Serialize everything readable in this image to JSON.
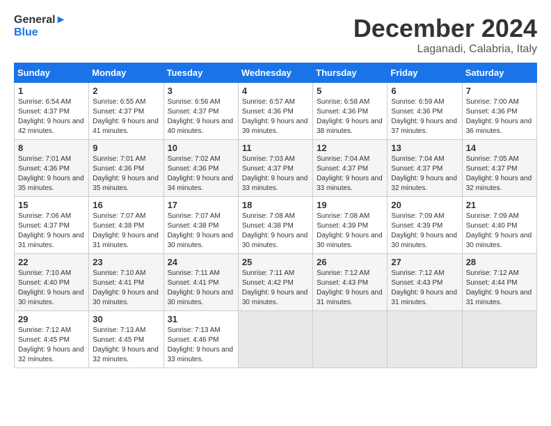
{
  "header": {
    "logo_general": "General",
    "logo_blue": "Blue",
    "month_title": "December 2024",
    "location": "Laganadi, Calabria, Italy"
  },
  "calendar": {
    "days_of_week": [
      "Sunday",
      "Monday",
      "Tuesday",
      "Wednesday",
      "Thursday",
      "Friday",
      "Saturday"
    ],
    "weeks": [
      [
        null,
        null,
        null,
        null,
        null,
        null,
        null
      ]
    ],
    "cells": [
      {
        "day": "",
        "info": ""
      },
      {
        "day": "",
        "info": ""
      },
      {
        "day": "",
        "info": ""
      },
      {
        "day": "",
        "info": ""
      },
      {
        "day": "",
        "info": ""
      },
      {
        "day": "",
        "info": ""
      },
      {
        "day": "7",
        "sunrise": "Sunrise: 7:00 AM",
        "sunset": "Sunset: 4:36 PM",
        "daylight": "Daylight: 9 hours and 36 minutes."
      },
      {
        "day": "8",
        "sunrise": "Sunrise: 7:01 AM",
        "sunset": "Sunset: 4:36 PM",
        "daylight": "Daylight: 9 hours and 35 minutes."
      },
      {
        "day": "9",
        "sunrise": "Sunrise: 7:01 AM",
        "sunset": "Sunset: 4:36 PM",
        "daylight": "Daylight: 9 hours and 35 minutes."
      },
      {
        "day": "10",
        "sunrise": "Sunrise: 7:02 AM",
        "sunset": "Sunset: 4:36 PM",
        "daylight": "Daylight: 9 hours and 34 minutes."
      },
      {
        "day": "11",
        "sunrise": "Sunrise: 7:03 AM",
        "sunset": "Sunset: 4:37 PM",
        "daylight": "Daylight: 9 hours and 33 minutes."
      },
      {
        "day": "12",
        "sunrise": "Sunrise: 7:04 AM",
        "sunset": "Sunset: 4:37 PM",
        "daylight": "Daylight: 9 hours and 33 minutes."
      },
      {
        "day": "13",
        "sunrise": "Sunrise: 7:04 AM",
        "sunset": "Sunset: 4:37 PM",
        "daylight": "Daylight: 9 hours and 32 minutes."
      },
      {
        "day": "14",
        "sunrise": "Sunrise: 7:05 AM",
        "sunset": "Sunset: 4:37 PM",
        "daylight": "Daylight: 9 hours and 32 minutes."
      },
      {
        "day": "15",
        "sunrise": "Sunrise: 7:06 AM",
        "sunset": "Sunset: 4:37 PM",
        "daylight": "Daylight: 9 hours and 31 minutes."
      },
      {
        "day": "16",
        "sunrise": "Sunrise: 7:07 AM",
        "sunset": "Sunset: 4:38 PM",
        "daylight": "Daylight: 9 hours and 31 minutes."
      },
      {
        "day": "17",
        "sunrise": "Sunrise: 7:07 AM",
        "sunset": "Sunset: 4:38 PM",
        "daylight": "Daylight: 9 hours and 30 minutes."
      },
      {
        "day": "18",
        "sunrise": "Sunrise: 7:08 AM",
        "sunset": "Sunset: 4:38 PM",
        "daylight": "Daylight: 9 hours and 30 minutes."
      },
      {
        "day": "19",
        "sunrise": "Sunrise: 7:08 AM",
        "sunset": "Sunset: 4:39 PM",
        "daylight": "Daylight: 9 hours and 30 minutes."
      },
      {
        "day": "20",
        "sunrise": "Sunrise: 7:09 AM",
        "sunset": "Sunset: 4:39 PM",
        "daylight": "Daylight: 9 hours and 30 minutes."
      },
      {
        "day": "21",
        "sunrise": "Sunrise: 7:09 AM",
        "sunset": "Sunset: 4:40 PM",
        "daylight": "Daylight: 9 hours and 30 minutes."
      },
      {
        "day": "22",
        "sunrise": "Sunrise: 7:10 AM",
        "sunset": "Sunset: 4:40 PM",
        "daylight": "Daylight: 9 hours and 30 minutes."
      },
      {
        "day": "23",
        "sunrise": "Sunrise: 7:10 AM",
        "sunset": "Sunset: 4:41 PM",
        "daylight": "Daylight: 9 hours and 30 minutes."
      },
      {
        "day": "24",
        "sunrise": "Sunrise: 7:11 AM",
        "sunset": "Sunset: 4:41 PM",
        "daylight": "Daylight: 9 hours and 30 minutes."
      },
      {
        "day": "25",
        "sunrise": "Sunrise: 7:11 AM",
        "sunset": "Sunset: 4:42 PM",
        "daylight": "Daylight: 9 hours and 30 minutes."
      },
      {
        "day": "26",
        "sunrise": "Sunrise: 7:12 AM",
        "sunset": "Sunset: 4:43 PM",
        "daylight": "Daylight: 9 hours and 31 minutes."
      },
      {
        "day": "27",
        "sunrise": "Sunrise: 7:12 AM",
        "sunset": "Sunset: 4:43 PM",
        "daylight": "Daylight: 9 hours and 31 minutes."
      },
      {
        "day": "28",
        "sunrise": "Sunrise: 7:12 AM",
        "sunset": "Sunset: 4:44 PM",
        "daylight": "Daylight: 9 hours and 31 minutes."
      },
      {
        "day": "29",
        "sunrise": "Sunrise: 7:12 AM",
        "sunset": "Sunset: 4:45 PM",
        "daylight": "Daylight: 9 hours and 32 minutes."
      },
      {
        "day": "30",
        "sunrise": "Sunrise: 7:13 AM",
        "sunset": "Sunset: 4:45 PM",
        "daylight": "Daylight: 9 hours and 32 minutes."
      },
      {
        "day": "31",
        "sunrise": "Sunrise: 7:13 AM",
        "sunset": "Sunset: 4:46 PM",
        "daylight": "Daylight: 9 hours and 33 minutes."
      },
      {
        "day": "",
        "info": ""
      },
      {
        "day": "",
        "info": ""
      },
      {
        "day": "",
        "info": ""
      },
      {
        "day": "",
        "info": ""
      }
    ],
    "week1": [
      {
        "day": "1",
        "sunrise": "Sunrise: 6:54 AM",
        "sunset": "Sunset: 4:37 PM",
        "daylight": "Daylight: 9 hours and 42 minutes."
      },
      {
        "day": "2",
        "sunrise": "Sunrise: 6:55 AM",
        "sunset": "Sunset: 4:37 PM",
        "daylight": "Daylight: 9 hours and 41 minutes."
      },
      {
        "day": "3",
        "sunrise": "Sunrise: 6:56 AM",
        "sunset": "Sunset: 4:37 PM",
        "daylight": "Daylight: 9 hours and 40 minutes."
      },
      {
        "day": "4",
        "sunrise": "Sunrise: 6:57 AM",
        "sunset": "Sunset: 4:36 PM",
        "daylight": "Daylight: 9 hours and 39 minutes."
      },
      {
        "day": "5",
        "sunrise": "Sunrise: 6:58 AM",
        "sunset": "Sunset: 4:36 PM",
        "daylight": "Daylight: 9 hours and 38 minutes."
      },
      {
        "day": "6",
        "sunrise": "Sunrise: 6:59 AM",
        "sunset": "Sunset: 4:36 PM",
        "daylight": "Daylight: 9 hours and 37 minutes."
      }
    ]
  }
}
